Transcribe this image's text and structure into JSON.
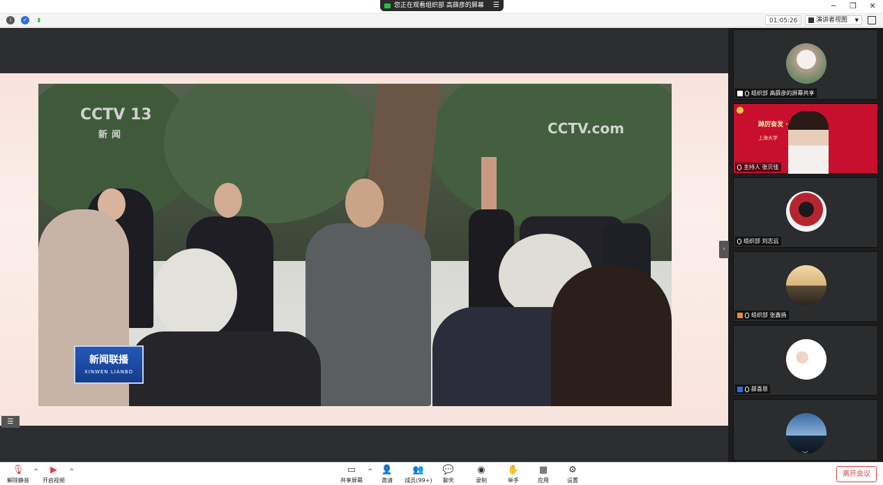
{
  "top_bar": {
    "share_banner": "您正在观看组织部 高薛彦的屏幕",
    "menu_icon": "menu-icon",
    "window_controls": [
      "minimize-icon",
      "restore-icon",
      "close-icon"
    ]
  },
  "info_bar": {
    "icons": [
      "info-icon",
      "shield-icon",
      "signal-icon"
    ],
    "timer": "01:05:26",
    "view_mode": "演讲者视图",
    "fullscreen_icon": "fullscreen-icon"
  },
  "video": {
    "watermark_left": "CCTV 13",
    "watermark_left_sub": "新闻",
    "watermark_right": "CCTV.com",
    "program_logo": "新闻联播",
    "program_logo_sub": "XINWEN LIANBO"
  },
  "participants": [
    {
      "label": "组织部 高薛彦的屏幕共享",
      "icon": "screen-share-icon",
      "avatar": "woman-portrait"
    },
    {
      "label": "主持人 张贝佳",
      "icon": "mic-muted-icon",
      "avatar": "host-video",
      "video_text_top": "踔厉奋发 · 献礼二十大",
      "video_text_sub": "上海大学"
    },
    {
      "label": "组织部 刘志远",
      "icon": "mic-muted-icon",
      "avatar": "cartoon-avatar"
    },
    {
      "label": "组织部 张鑫扬",
      "icon": "mic-muted-icon",
      "avatar": "sunset-silhouette"
    },
    {
      "label": "薛喜恩",
      "icon": "mic-muted-icon",
      "avatar": "cartoon-couple"
    },
    {
      "label": "",
      "icon": "",
      "avatar": "mountain-night"
    }
  ],
  "toolbar": {
    "left": [
      {
        "label": "解除静音",
        "icon": "mic-muted-icon"
      },
      {
        "label": "开启视频",
        "icon": "camera-off-icon"
      }
    ],
    "center": [
      {
        "label": "共享屏幕",
        "icon": "share-screen-icon"
      },
      {
        "label": "邀请",
        "icon": "invite-icon"
      },
      {
        "label": "成员(99+)",
        "icon": "members-icon"
      },
      {
        "label": "聊天",
        "icon": "chat-icon"
      },
      {
        "label": "录制",
        "icon": "record-icon"
      },
      {
        "label": "举手",
        "icon": "hand-icon"
      },
      {
        "label": "应用",
        "icon": "apps-icon"
      },
      {
        "label": "设置",
        "icon": "settings-icon"
      }
    ],
    "leave": "离开会议"
  },
  "colors": {
    "accent_blue": "#2f6fde",
    "leave_red": "#e04040",
    "host_bg": "#c8102e"
  }
}
